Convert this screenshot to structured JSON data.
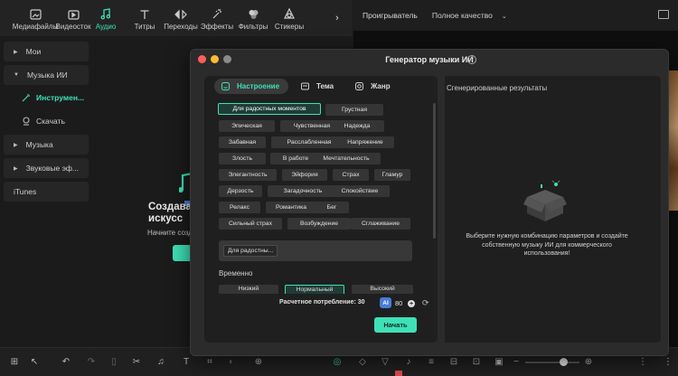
{
  "toolbar": {
    "items": [
      {
        "label": "Медиафайлы",
        "icon": "media-icon"
      },
      {
        "label": "Видеосток",
        "icon": "stock-video-icon"
      },
      {
        "label": "Аудио",
        "icon": "music-note-icon",
        "active": true
      },
      {
        "label": "Титры",
        "icon": "text-icon"
      },
      {
        "label": "Переходы",
        "icon": "transitions-icon"
      },
      {
        "label": "Эффекты",
        "icon": "effects-icon"
      },
      {
        "label": "Фильтры",
        "icon": "filters-icon"
      },
      {
        "label": "Стикеры",
        "icon": "stickers-icon"
      }
    ],
    "more": "›"
  },
  "player": {
    "title": "Проигрыватель",
    "quality": "Полное качество"
  },
  "sidebar": {
    "items": [
      {
        "label": "Мои",
        "expanded": false
      },
      {
        "label": "Музыка ИИ",
        "expanded": true
      },
      {
        "label": "Музыка",
        "expanded": false
      },
      {
        "label": "Звуковые эф...",
        "expanded": false
      },
      {
        "label": "iTunes"
      }
    ],
    "subitems": [
      {
        "label": "Инструмен...",
        "active": true
      },
      {
        "label": "Скачать"
      }
    ]
  },
  "main": {
    "title_line1": "Создава",
    "title_line2": "искусс",
    "subtitle": "Начните созд"
  },
  "dialog": {
    "title": "Генератор музыки ИИ",
    "tabs": [
      {
        "label": "Настроение",
        "active": true
      },
      {
        "label": "Тема"
      },
      {
        "label": "Жанр"
      }
    ],
    "moods": [
      "Для радостных моментов",
      "Грустная",
      "Эпическая",
      "Чувственная",
      "Надежда",
      "Забавная",
      "Расслабленная",
      "Напряжение",
      "Злость",
      "В работе",
      "Мечтательность",
      "Элегантность",
      "Эйфория",
      "Страх",
      "Гламур",
      "Дерзость",
      "Загадочность",
      "Спокойствие",
      "Релакс",
      "Романтика",
      "Бег",
      "Сильный страх",
      "Возбуждение",
      "Сглаживание"
    ],
    "selected_mood": "Для радостных моментов",
    "selected_chip": "Для радостны...",
    "tempo_label": "Временно",
    "tempos": [
      {
        "label": "Низкий"
      },
      {
        "label": "Нормальный",
        "selected": true
      },
      {
        "label": "Высокий"
      }
    ],
    "cost_label": "Расчетное потребление: 30",
    "ai_badge": "AI",
    "credits": "80",
    "start_button": "Начать",
    "results_title": "Сгенерированные результаты",
    "results_message": "Выберите нужную комбинацию параметров и создайте собственную музыку ИИ для коммерческого использования!"
  },
  "colors": {
    "accent": "#3ee1b6",
    "dot_close": "#ff5f57",
    "dot_min": "#febc2e",
    "dot_max": "#8a8a8a"
  }
}
